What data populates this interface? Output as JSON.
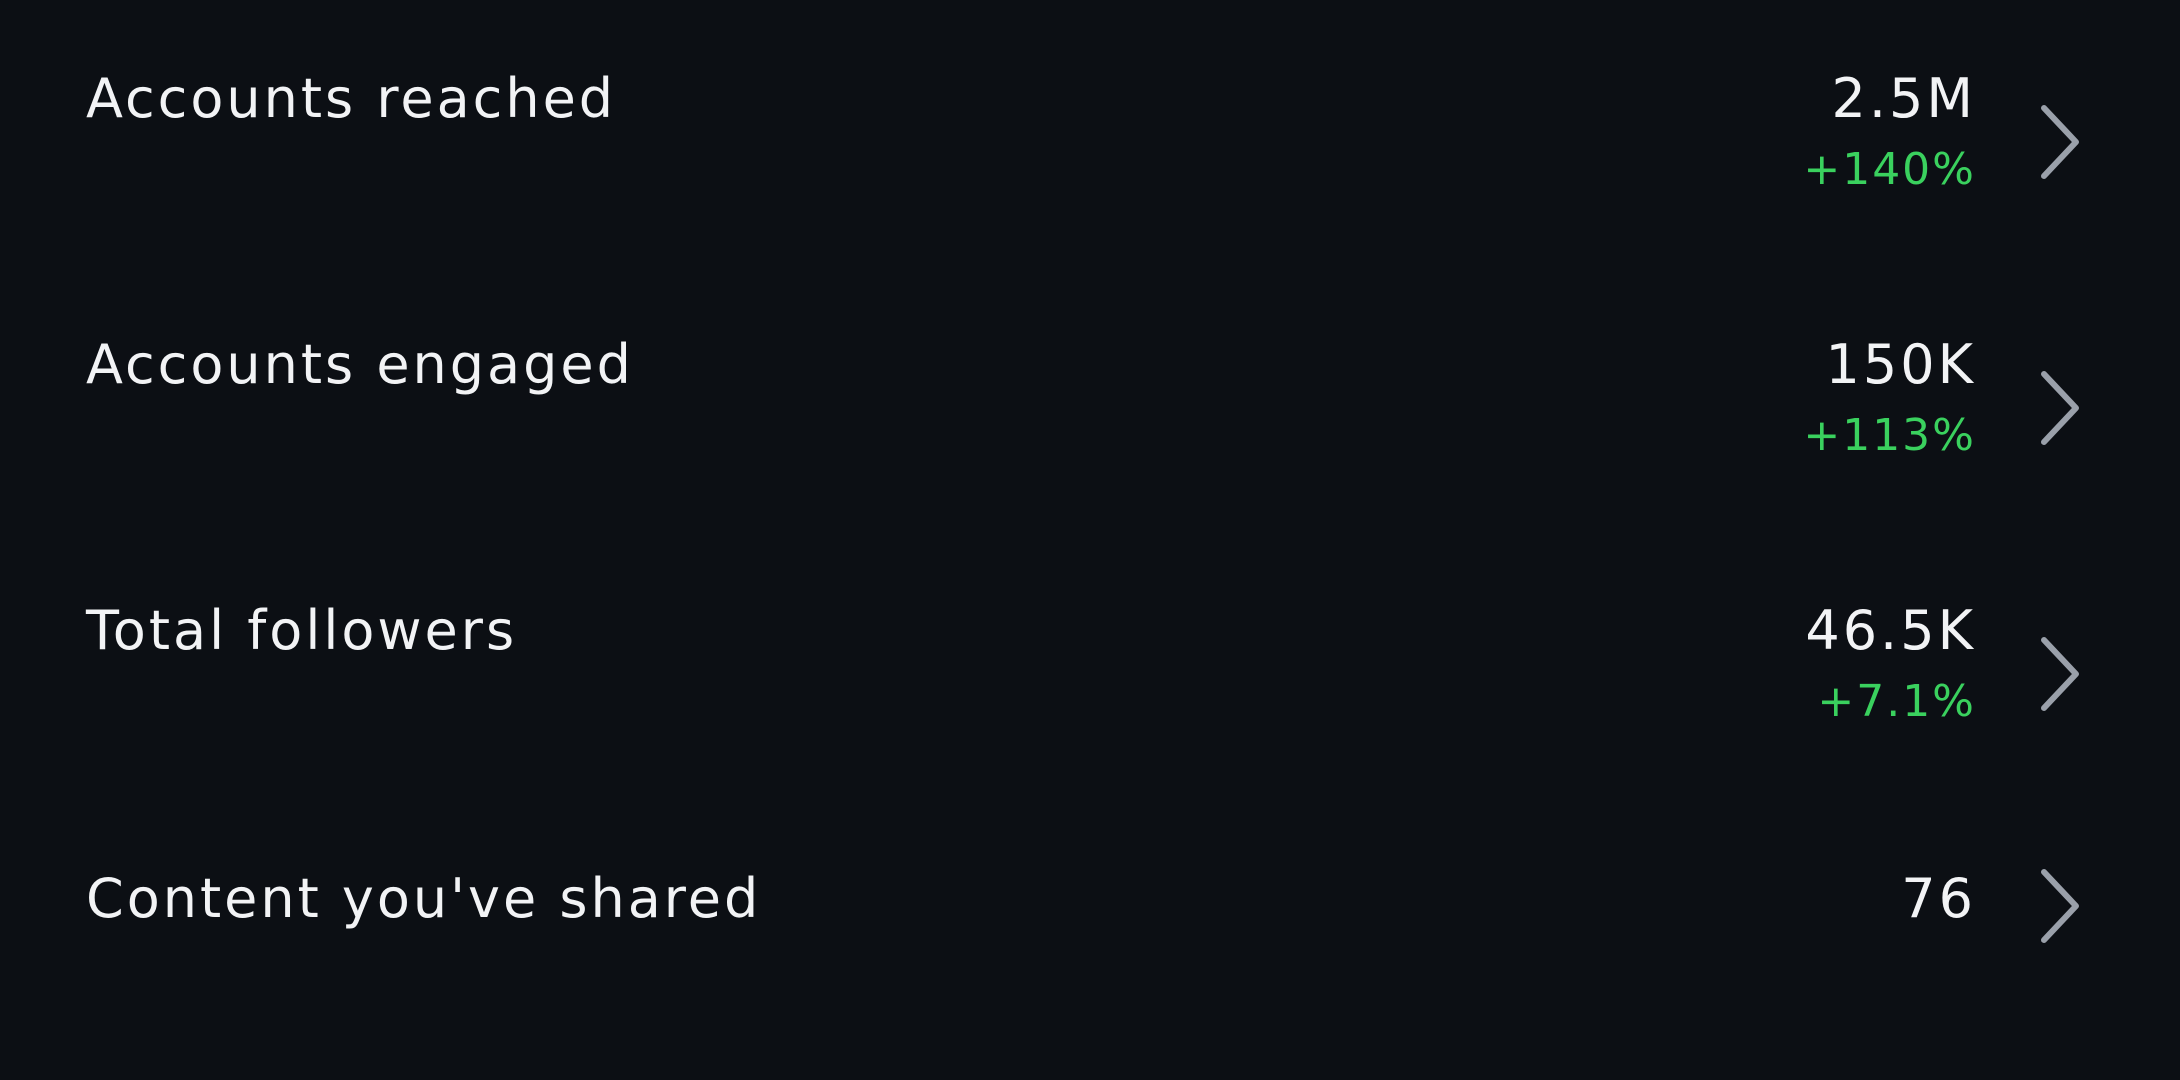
{
  "insights": {
    "rows": [
      {
        "label": "Accounts reached",
        "value": "2.5M",
        "change": "+140%"
      },
      {
        "label": "Accounts engaged",
        "value": "150K",
        "change": "+113%"
      },
      {
        "label": "Total followers",
        "value": "46.5K",
        "change": "+7.1%"
      },
      {
        "label": "Content you've shared",
        "value": "76"
      }
    ]
  },
  "colors": {
    "background": "#0c0f14",
    "text": "#f2f3f5",
    "positive_change": "#3ad15e",
    "chevron": "#9aa0aa"
  },
  "icons": {
    "row_action": "chevron-right-icon"
  }
}
